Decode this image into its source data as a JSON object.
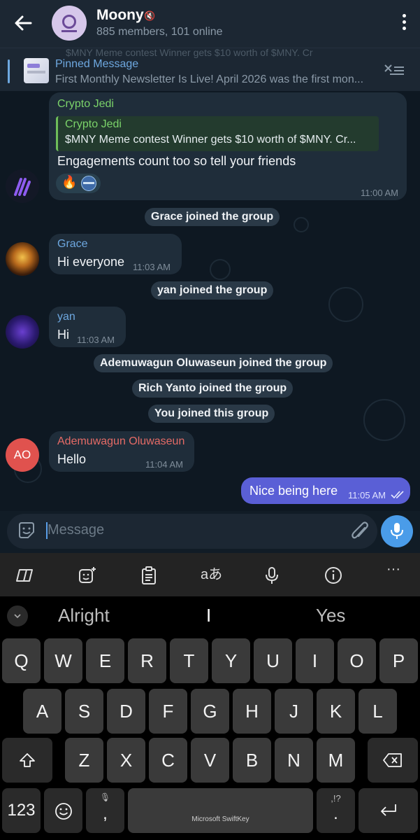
{
  "header": {
    "back_icon": "arrow-left-icon",
    "title": "Moony",
    "muted_icon": "muted-icon",
    "subtitle": "885 members, 101 online",
    "menu_icon": "more-vertical-icon"
  },
  "pinned": {
    "ghost_text": "$MNY Meme contest  Winner gets $10 worth of $MNY. Cr",
    "label": "Pinned Message",
    "text": "First Monthly Newsletter Is Live!  April 2026 was the first mon...",
    "list_icon": "pin-list-icon"
  },
  "messages": {
    "crypto_jedi": {
      "sender": "Crypto Jedi",
      "reply_sender": "Crypto Jedi",
      "reply_text": "$MNY Meme contest  Winner gets $10 worth of $MNY.  Cr...",
      "text": "Engagements count too so tell your friends",
      "time": "11:00 AM",
      "reaction": "🔥",
      "sender_color": "#7bd36a"
    },
    "grace_join": "Grace joined the group",
    "grace": {
      "sender": "Grace",
      "text": "Hi everyone",
      "time": "11:03 AM",
      "sender_color": "#6ea8e0"
    },
    "yan_join": "yan joined the group",
    "yan": {
      "sender": "yan",
      "text": "Hi",
      "time": "11:03 AM",
      "sender_color": "#6ea8e0"
    },
    "ademuwagun_join": "Ademuwagun Oluwaseun joined the group",
    "rich_join": "Rich Yanto joined the group",
    "you_join": "You joined this group",
    "ademuwagun": {
      "initials": "AO",
      "sender": "Ademuwagun Oluwaseun",
      "text": "Hello",
      "time": "11:04 AM",
      "sender_color": "#e56b66"
    },
    "own": {
      "text": "Nice being here",
      "time": "11:05 AM",
      "status_icon": "double-check-icon"
    }
  },
  "input": {
    "placeholder": "Message",
    "sticker_icon": "sticker-icon",
    "attach_icon": "paperclip-icon",
    "mic_icon": "microphone-icon"
  },
  "keyboard": {
    "toolbar": [
      "copilot-icon",
      "emoji-sparkle-icon",
      "clipboard-icon",
      "translate-icon",
      "microphone-icon",
      "info-icon",
      "more-horizontal-icon"
    ],
    "translate_glyph": "aあ",
    "more_glyph": "···",
    "suggestions": [
      "Alright",
      "I",
      "Yes"
    ],
    "row1": [
      "Q",
      "W",
      "E",
      "R",
      "T",
      "Y",
      "U",
      "I",
      "O",
      "P"
    ],
    "row2": [
      "A",
      "S",
      "D",
      "F",
      "G",
      "H",
      "J",
      "K",
      "L"
    ],
    "row3": [
      "Z",
      "X",
      "C",
      "V",
      "B",
      "N",
      "M"
    ],
    "num_key": "123",
    "comma": ",",
    "space_label": "Microsoft SwiftKey",
    "period": ".",
    "period_alt": ",!?",
    "accent": "#4a9ce9"
  }
}
